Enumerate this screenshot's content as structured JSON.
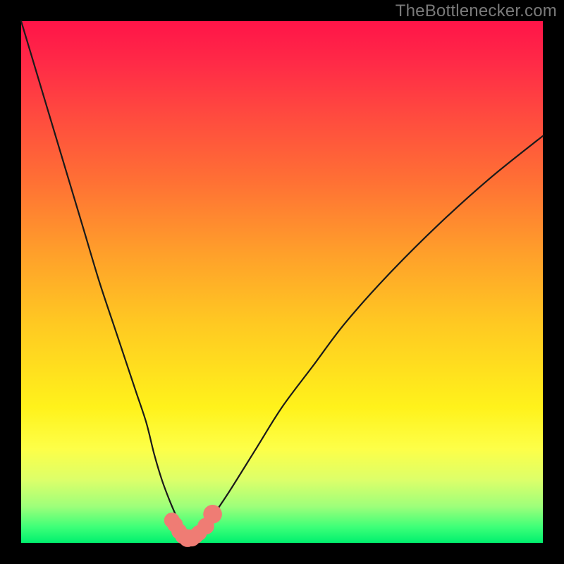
{
  "watermark": "TheBottlenecker.com",
  "colors": {
    "frame_bg": "#000000",
    "curve_stroke": "#1a1a1a",
    "marker_fill": "#ef7c74",
    "gradient_stops": [
      "#ff1448",
      "#ff2a47",
      "#ff4a3f",
      "#ff6e35",
      "#ffa12a",
      "#ffc922",
      "#fff21b",
      "#fdff48",
      "#dcff6a",
      "#9eff7a",
      "#3dff78",
      "#00f06e"
    ]
  },
  "chart_data": {
    "type": "line",
    "title": "",
    "xlabel": "",
    "ylabel": "",
    "xlim": [
      0,
      100
    ],
    "ylim": [
      0,
      100
    ],
    "series": [
      {
        "name": "bottleneck-curve",
        "x": [
          0,
          3,
          6,
          9,
          12,
          15,
          18,
          20,
          22,
          24,
          25.5,
          27,
          28.5,
          30,
          31,
          31.7,
          32.5,
          33.5,
          35,
          37,
          40,
          45,
          50,
          56,
          62,
          70,
          80,
          90,
          100
        ],
        "y": [
          100,
          90,
          80,
          70,
          60,
          50,
          41,
          35,
          29,
          23,
          17,
          12,
          8,
          4.5,
          2.2,
          1.1,
          1.0,
          1.3,
          2.5,
          5.5,
          10,
          18,
          26,
          34,
          42,
          51,
          61,
          70,
          78
        ]
      }
    ],
    "markers": [
      {
        "x": 28.9,
        "y": 4.3,
        "r": 1.5
      },
      {
        "x": 29.5,
        "y": 3.5,
        "r": 1.5
      },
      {
        "x": 30.3,
        "y": 2.2,
        "r": 1.5
      },
      {
        "x": 31.0,
        "y": 1.3,
        "r": 1.5
      },
      {
        "x": 31.9,
        "y": 0.9,
        "r": 1.7
      },
      {
        "x": 32.7,
        "y": 0.9,
        "r": 1.6
      },
      {
        "x": 33.4,
        "y": 1.3,
        "r": 1.5
      },
      {
        "x": 34.1,
        "y": 1.9,
        "r": 1.5
      },
      {
        "x": 35.4,
        "y": 3.2,
        "r": 1.6
      },
      {
        "x": 36.7,
        "y": 5.5,
        "r": 1.8
      }
    ]
  }
}
